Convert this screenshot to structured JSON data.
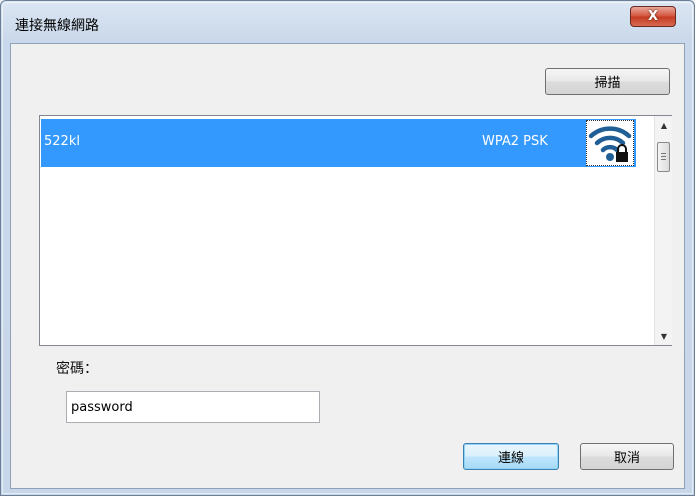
{
  "dialog": {
    "title": "連接無線網路",
    "close_label": "X"
  },
  "toolbar": {
    "scan_label": "掃描"
  },
  "network_list": {
    "items": [
      {
        "ssid": "522kl",
        "security": "WPA2 PSK",
        "icon": "wifi-lock-icon",
        "selected": true
      }
    ]
  },
  "password": {
    "label": "密碼：",
    "value": "password"
  },
  "actions": {
    "connect_label": "連線",
    "cancel_label": "取消"
  },
  "colors": {
    "selection": "#3399ff",
    "wifi_icon": "#1f5f96",
    "close_button": "#c43b22"
  }
}
